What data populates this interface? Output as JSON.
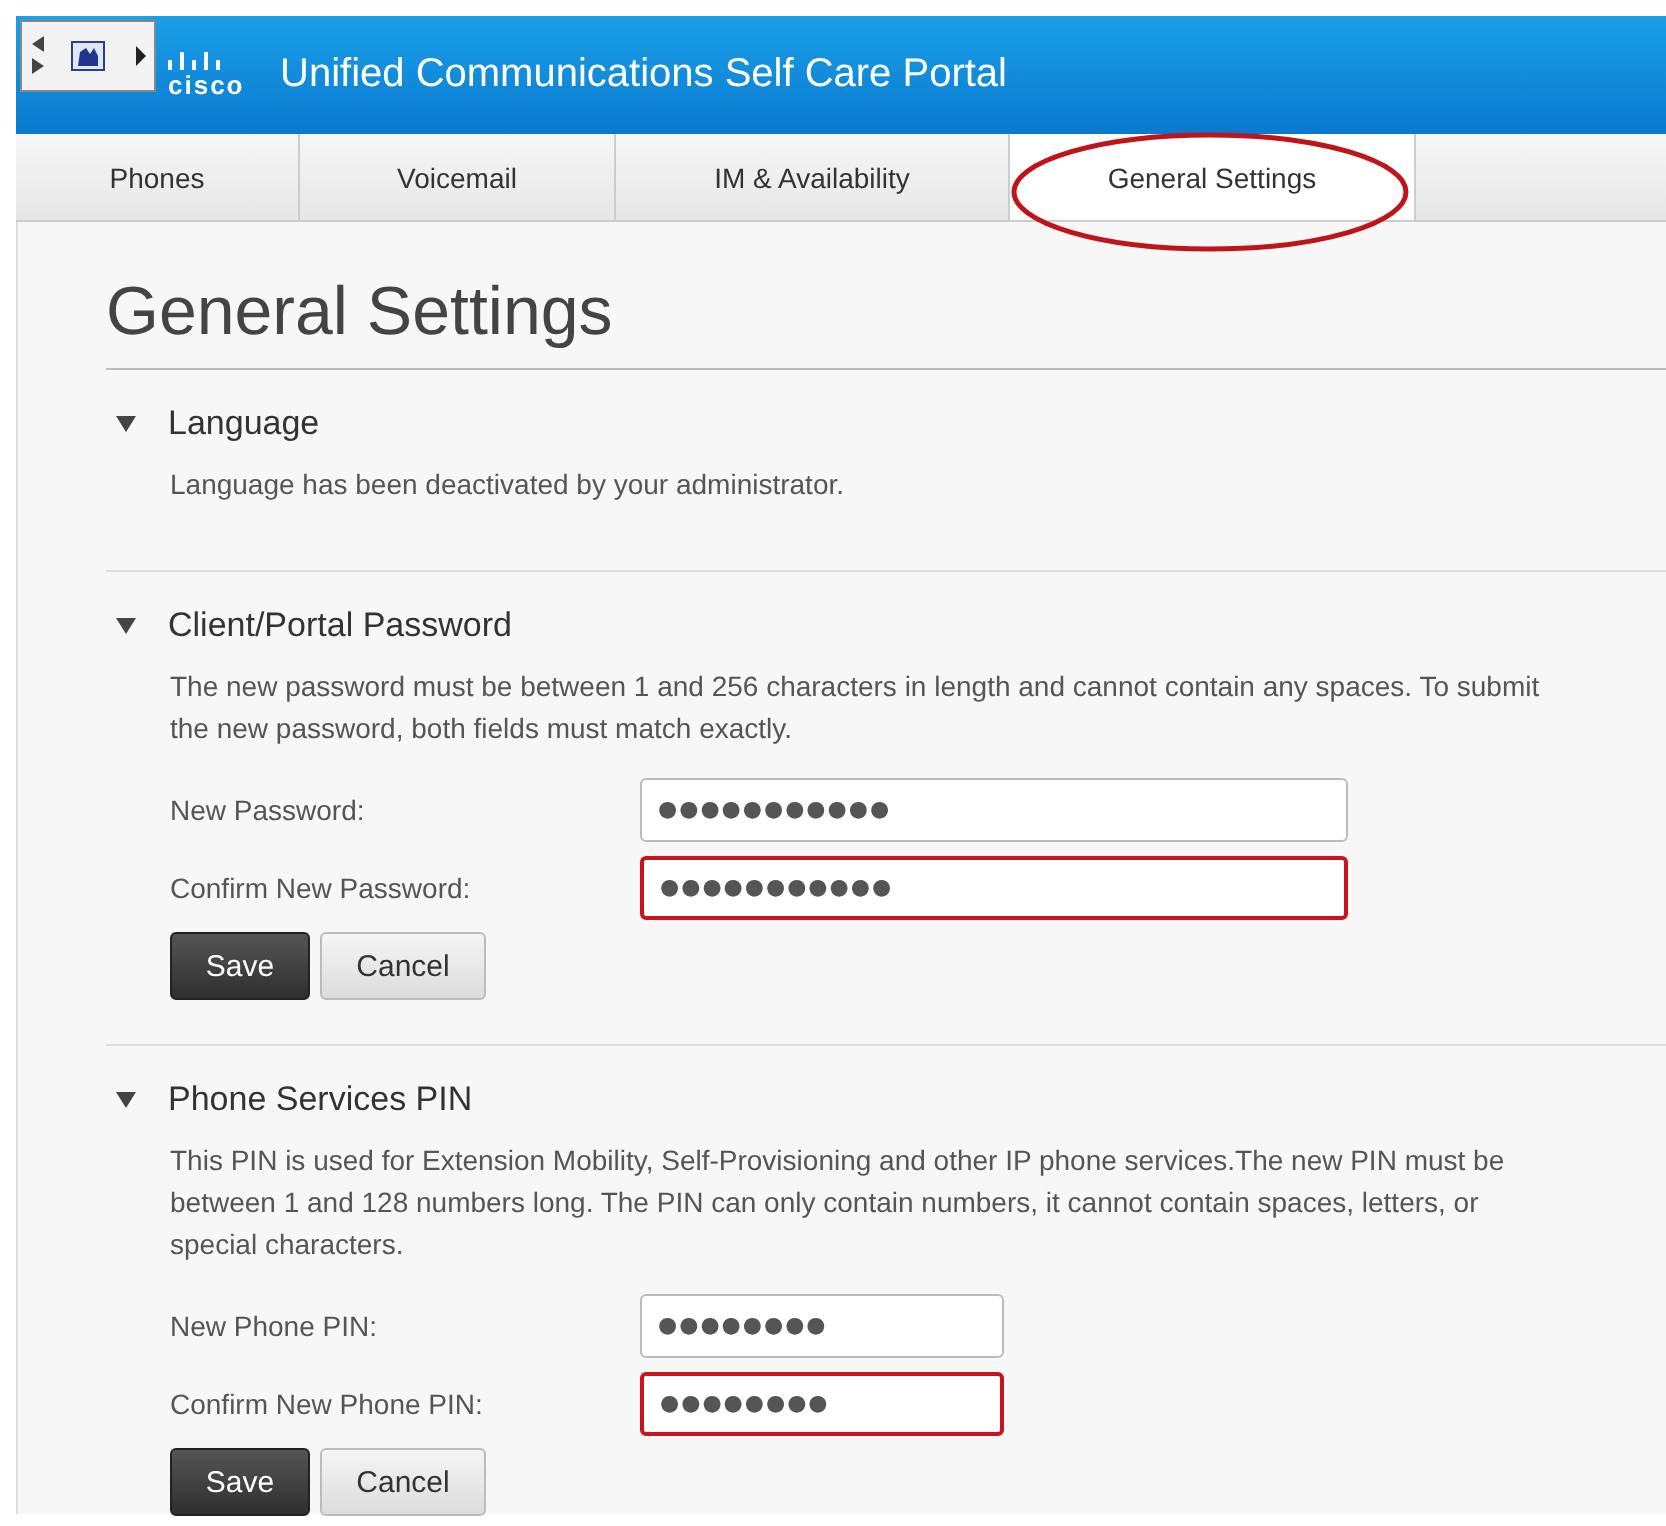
{
  "header": {
    "logo": "cisco",
    "title": "Unified Communications Self Care Portal"
  },
  "tabs": [
    {
      "label": "Phones",
      "selected": false
    },
    {
      "label": "Voicemail",
      "selected": false
    },
    {
      "label": "IM & Availability",
      "selected": false
    },
    {
      "label": "General Settings",
      "selected": true,
      "circled": true
    }
  ],
  "page_title": "General Settings",
  "sections": [
    {
      "title": "Language",
      "expanded": true,
      "description": "Language has been deactivated by your administrator."
    },
    {
      "title": "Client/Portal Password",
      "expanded": true,
      "description": "The new password must be between 1 and 256 characters in length and cannot contain any spaces. To submit the new password, both fields must match exactly.",
      "kind": "password",
      "fields": [
        {
          "label": "New Password:",
          "value": "●●●●●●●●●●●",
          "error": false
        },
        {
          "label": "Confirm New Password:",
          "value": "●●●●●●●●●●●",
          "error": true
        }
      ],
      "buttons": [
        {
          "label": "Save",
          "kind": "primary"
        },
        {
          "label": "Cancel",
          "kind": "secondary"
        }
      ]
    },
    {
      "title": "Phone Services PIN",
      "expanded": true,
      "description": "This PIN is used for Extension Mobility, Self-Provisioning and other IP phone services.The new PIN must be between 1 and 128 numbers long. The PIN can only contain numbers, it cannot contain spaces, letters, or special characters.",
      "kind": "pin",
      "fields": [
        {
          "label": "New Phone PIN:",
          "value": "●●●●●●●●",
          "error": false
        },
        {
          "label": "Confirm New Phone PIN:",
          "value": "●●●●●●●●",
          "error": true
        }
      ],
      "buttons": [
        {
          "label": "Save",
          "kind": "primary"
        },
        {
          "label": "Cancel",
          "kind": "secondary"
        }
      ]
    }
  ]
}
